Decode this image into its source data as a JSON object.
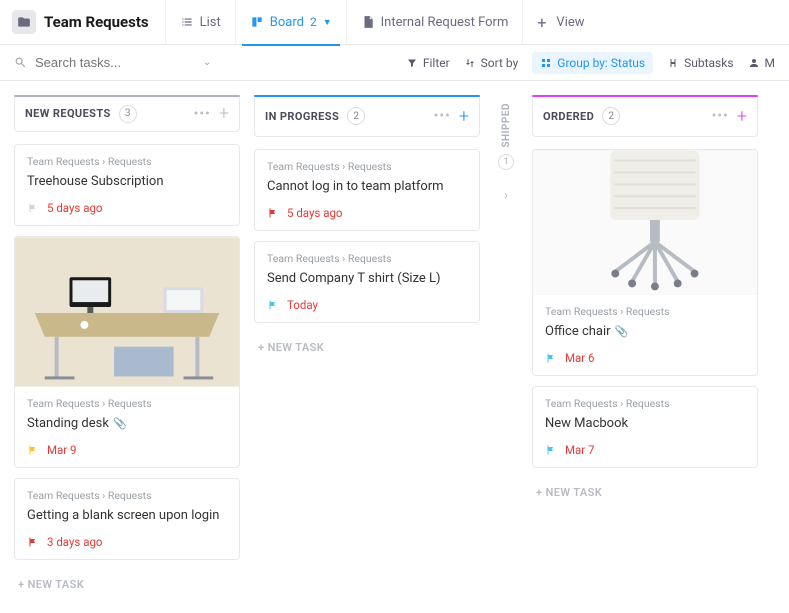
{
  "header": {
    "title": "Team Requests",
    "tabs": {
      "list": "List",
      "board": "Board",
      "board_count": "2",
      "form": "Internal Request Form",
      "addView": "View"
    }
  },
  "toolbar": {
    "search_placeholder": "Search tasks...",
    "filter": "Filter",
    "sortby": "Sort by",
    "groupby": "Group by: Status",
    "subtasks": "Subtasks",
    "me_label": "M"
  },
  "columns": {
    "new": {
      "title": "NEW REQUESTS",
      "count": "3"
    },
    "progress": {
      "title": "IN PROGRESS",
      "count": "2"
    },
    "shipped": {
      "title": "SHIPPED",
      "count": "1"
    },
    "ordered": {
      "title": "ORDERED",
      "count": "2"
    }
  },
  "breadcrumb": "Team Requests  ›  Requests",
  "cards": {
    "treehouse": {
      "title": "Treehouse Subscription",
      "date": "5 days ago"
    },
    "desk": {
      "title": "Standing desk",
      "date": "Mar 9"
    },
    "blank": {
      "title": "Getting a blank screen upon login",
      "date": "3 days ago"
    },
    "login": {
      "title": "Cannot log in to team platform",
      "date": "5 days ago"
    },
    "tshirt": {
      "title": "Send Company T shirt (Size L)",
      "date": "Today"
    },
    "chair": {
      "title": "Office chair",
      "date": "Mar 6"
    },
    "macbook": {
      "title": "New Macbook",
      "date": "Mar 7"
    }
  },
  "newtask": "+ NEW TASK"
}
